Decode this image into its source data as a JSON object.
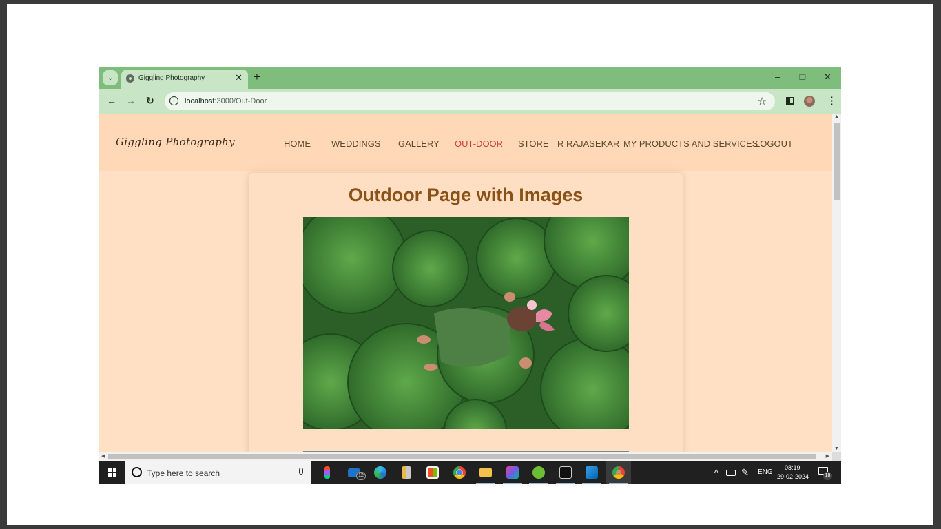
{
  "browser": {
    "tab": {
      "title": "Giggling Photography",
      "close": "✕"
    },
    "new_tab": "+",
    "window_controls": {
      "minimize": "–",
      "restore": "❐",
      "close": "✕"
    },
    "nav": {
      "back": "←",
      "forward": "→",
      "reload": "↻"
    },
    "address": {
      "host": "localhost",
      "path": ":3000/Out-Door",
      "site_info": "i"
    },
    "bookmark_star": "☆",
    "menu": "⋮"
  },
  "site": {
    "brand": "Giggling Photography",
    "nav": [
      {
        "label": "HOME"
      },
      {
        "label": "WEDDINGS"
      },
      {
        "label": "GALLERY"
      },
      {
        "label": "OUT-DOOR",
        "active": true
      },
      {
        "label": "STORE"
      },
      {
        "label": "R RAJASEKAR"
      },
      {
        "label": "MY PRODUCTS AND SERVICES"
      },
      {
        "label": "LOGOUT"
      }
    ],
    "heading": "Outdoor Page with Images",
    "active_color": "#d43b3b",
    "heading_color": "#8a5217"
  },
  "taskbar": {
    "search_placeholder": "Type here to search",
    "apps": [
      "figma-icon",
      "mail-icon",
      "edge-icon",
      "files-app-icon",
      "store-icon",
      "chrome-icon",
      "file-explorer-icon",
      "photos-icon",
      "torrent-icon",
      "terminal-icon",
      "vscode-icon",
      "chrome-profile-icon"
    ],
    "mail_badge": "12",
    "tray": {
      "chevron": "^",
      "language": "ENG"
    },
    "clock": {
      "time": "08:19",
      "date": "29-02-2024"
    },
    "notification_count": "18"
  },
  "icons": {
    "tab_favicon": "globe-icon",
    "tab_search": "chevron-down-icon",
    "side_panel": "side-panel-icon",
    "profile": "avatar"
  }
}
